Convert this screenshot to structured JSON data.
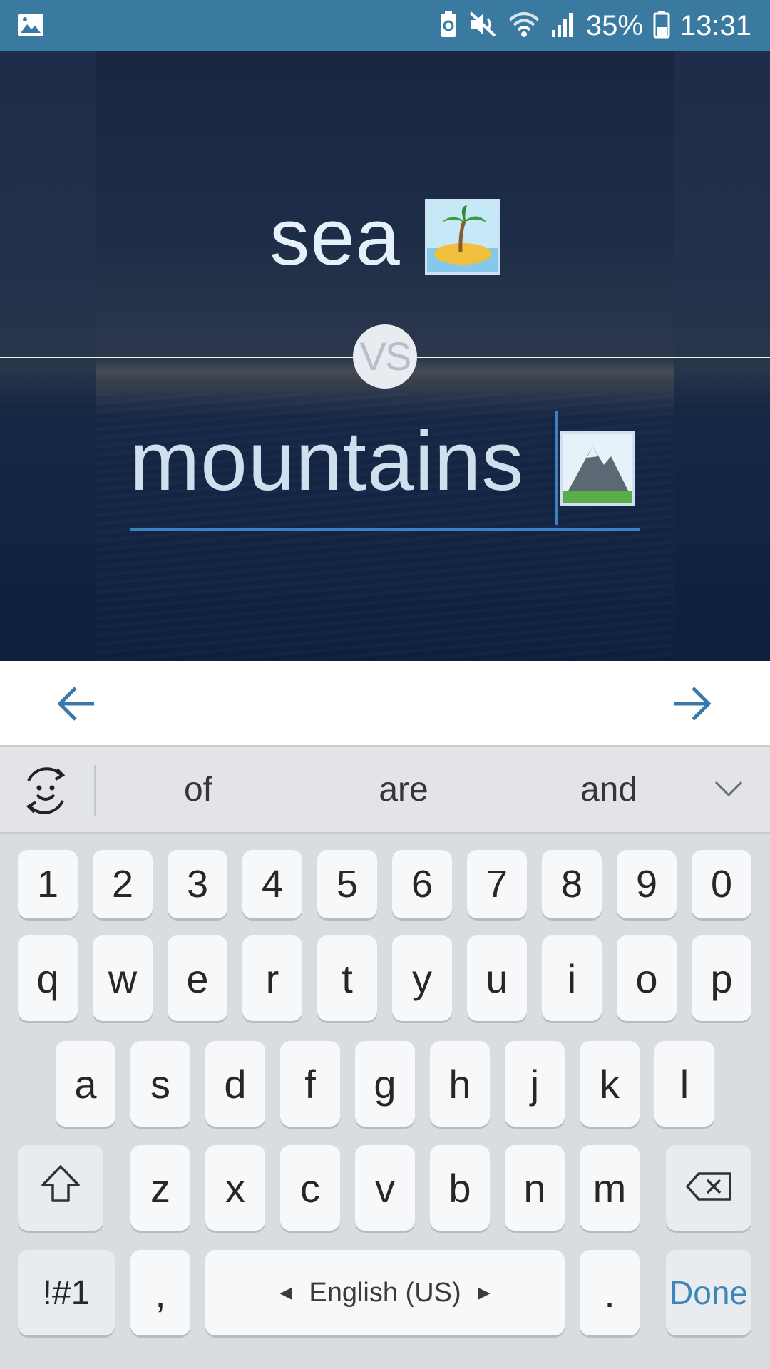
{
  "status_bar": {
    "battery_percent": "35%",
    "time": "13:31",
    "icons": [
      "gallery-icon",
      "battery-saver-icon",
      "mute-icon",
      "wifi-icon",
      "signal-icon",
      "battery-icon"
    ]
  },
  "hero": {
    "top_option": "sea",
    "top_emoji": "island-emoji-icon",
    "vs_label": "VS",
    "bottom_option": "mountains",
    "bottom_emoji": "mountain-emoji-icon"
  },
  "navigation": {
    "back_icon": "arrow-left-icon",
    "forward_icon": "arrow-right-icon"
  },
  "suggestions": {
    "words": [
      "of",
      "are",
      "and"
    ]
  },
  "keyboard": {
    "number_row": [
      "1",
      "2",
      "3",
      "4",
      "5",
      "6",
      "7",
      "8",
      "9",
      "0"
    ],
    "row1": [
      "q",
      "w",
      "e",
      "r",
      "t",
      "y",
      "u",
      "i",
      "o",
      "p"
    ],
    "row2": [
      "a",
      "s",
      "d",
      "f",
      "g",
      "h",
      "j",
      "k",
      "l"
    ],
    "row3": [
      "z",
      "x",
      "c",
      "v",
      "b",
      "n",
      "m"
    ],
    "symbols_label": "!#1",
    "comma_label": ",",
    "space_label": "English (US)",
    "period_label": ".",
    "done_label": "Done"
  },
  "colors": {
    "accent": "#3c82c0",
    "status_bar": "#3a7aa0",
    "done": "#3c86b9"
  }
}
